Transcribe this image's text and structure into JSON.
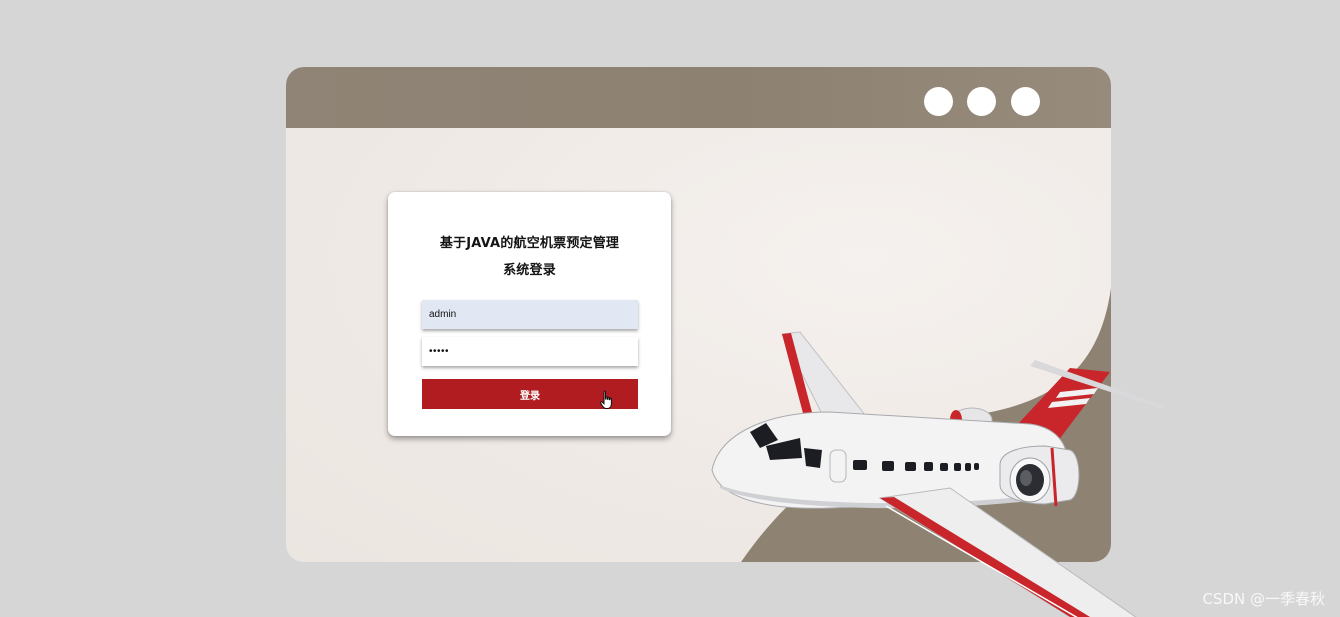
{
  "window": {
    "control_dots": [
      "window-dot",
      "window-dot",
      "window-dot"
    ],
    "colors": {
      "bar": "#8f8475",
      "body": "#f1ece8",
      "accent_shape": "#8e8272"
    }
  },
  "login": {
    "title_line1": "基于JAVA的航空机票预定管理",
    "title_line2": "系统登录",
    "username_value": "admin",
    "password_value": "•••••",
    "submit_label": "登录",
    "button_color": "#b01c1f"
  },
  "illustration": {
    "icon": "airplane-illustration"
  },
  "watermark": {
    "text": "CSDN @一季春秋"
  }
}
